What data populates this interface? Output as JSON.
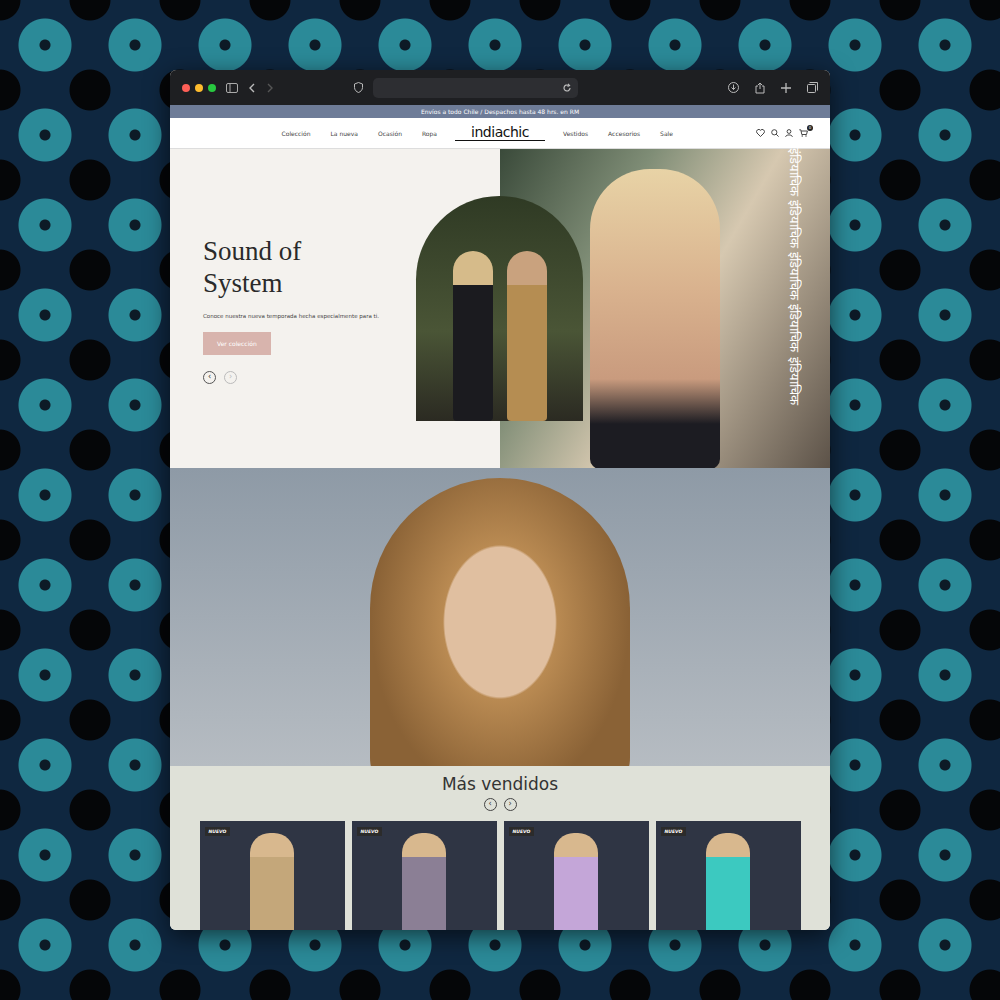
{
  "browser": {
    "url": "",
    "nav_back_enabled": true,
    "nav_forward_enabled": false
  },
  "banner": "Envíos a todo Chile / Despachos hasta 48 hrs. en RM",
  "nav": {
    "left": [
      "Colección",
      "La nueva",
      "Ocasión",
      "Ropa"
    ],
    "logo": "indiachic",
    "right": [
      "Vestidos",
      "Accesorios",
      "Sale"
    ],
    "cart_count": "0"
  },
  "hero": {
    "title": "Sound of System",
    "subtitle": "Conoce nuestra nueva temporada hecha especialmente para ti.",
    "button": "Ver colección",
    "arrows": [
      {
        "label": "‹",
        "disabled": false
      },
      {
        "label": "›",
        "disabled": true
      }
    ]
  },
  "strip": {
    "text": "इंडियाचिक इंडियाचिक इंडियाचिक इंडियाचिक इंडियाचिक"
  },
  "bestsellers": {
    "title": "Más vendidos",
    "arrows": [
      "‹",
      "›"
    ],
    "products": [
      {
        "badge": "NUEVO"
      },
      {
        "badge": "NUEVO"
      },
      {
        "badge": "NUEVO"
      },
      {
        "badge": "NUEVO"
      }
    ]
  }
}
